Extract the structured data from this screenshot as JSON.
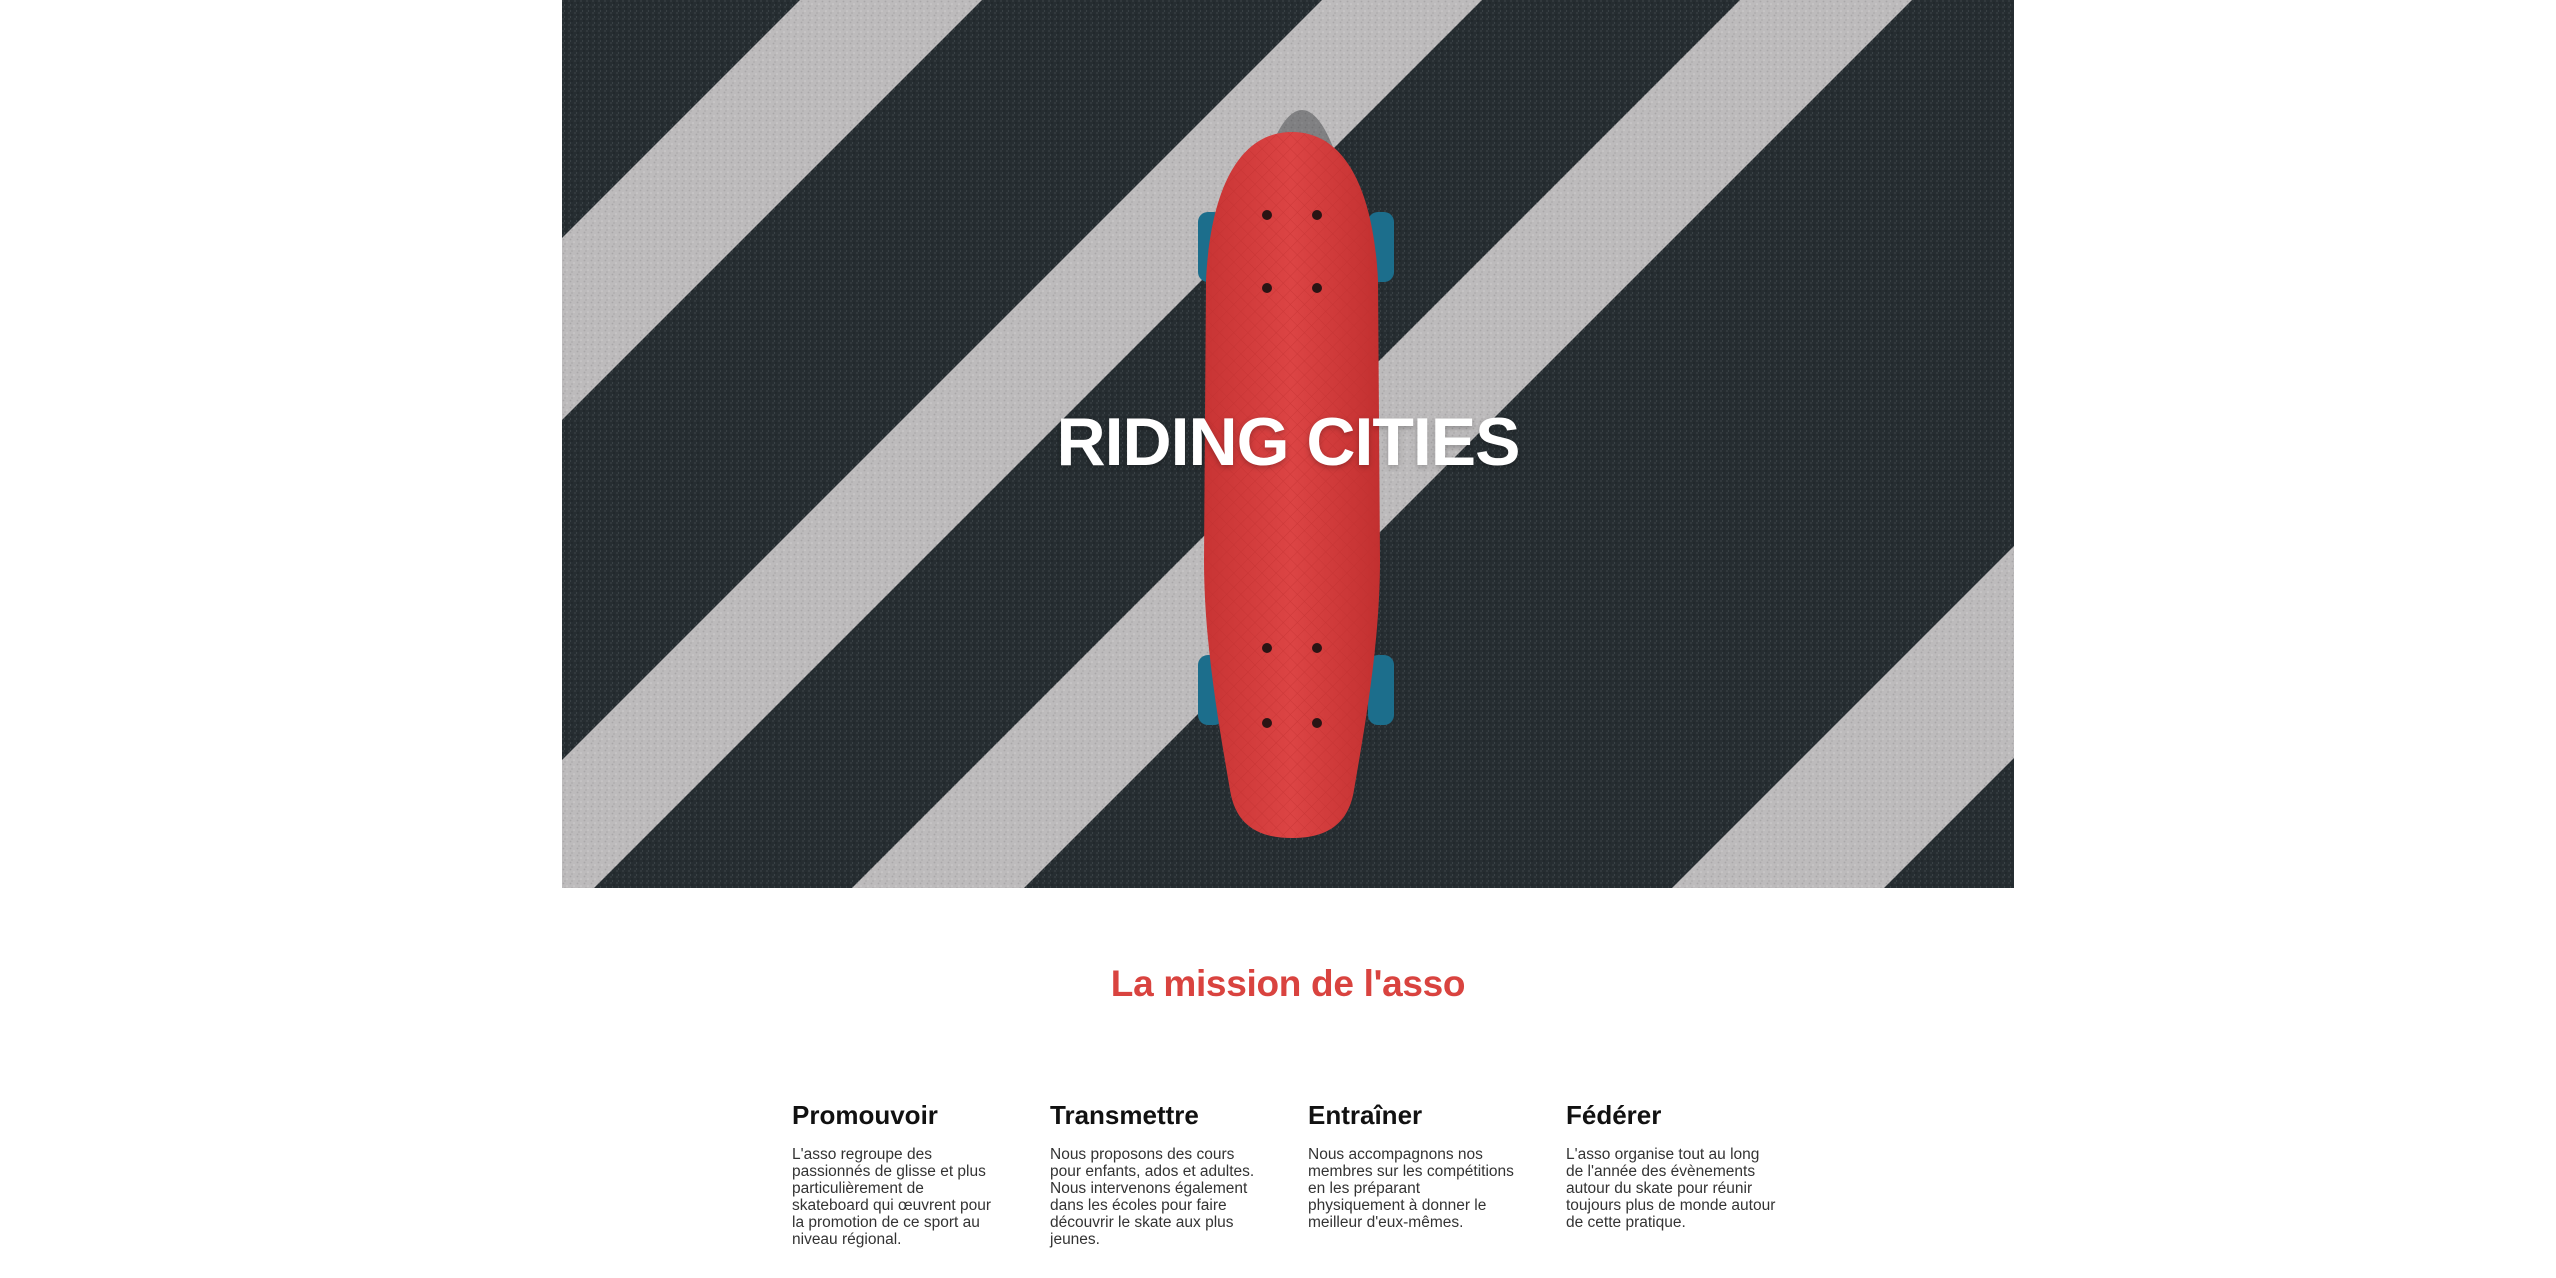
{
  "hero": {
    "title": "RIDING CITIES",
    "image": "skateboard-on-crosswalk"
  },
  "mission": {
    "title": "La mission de l'asso",
    "features": [
      {
        "title": "Promouvoir",
        "text": "L'asso regroupe des passionnés de glisse et plus particulièrement de skateboard qui œuvrent pour la promotion de ce sport au niveau régional."
      },
      {
        "title": "Transmettre",
        "text": "Nous proposons des cours pour enfants, ados et adultes. Nous intervenons également dans les écoles pour faire découvrir le skate aux plus jeunes."
      },
      {
        "title": "Entraîner",
        "text": "Nous accompagnons nos membres sur les compétitions en les préparant physiquement à donner le meilleur d'eux-mêmes."
      },
      {
        "title": "Fédérer",
        "text": "L'asso organise tout au long de l'année des évènements autour du skate pour réunir toujours plus de monde autour de cette pratique."
      }
    ]
  },
  "colors": {
    "accent": "#d9433f",
    "asphalt": "#262d31",
    "stripe": "#b9b7b8",
    "board": "#d63b3b",
    "wheels": "#1c6e8c"
  }
}
